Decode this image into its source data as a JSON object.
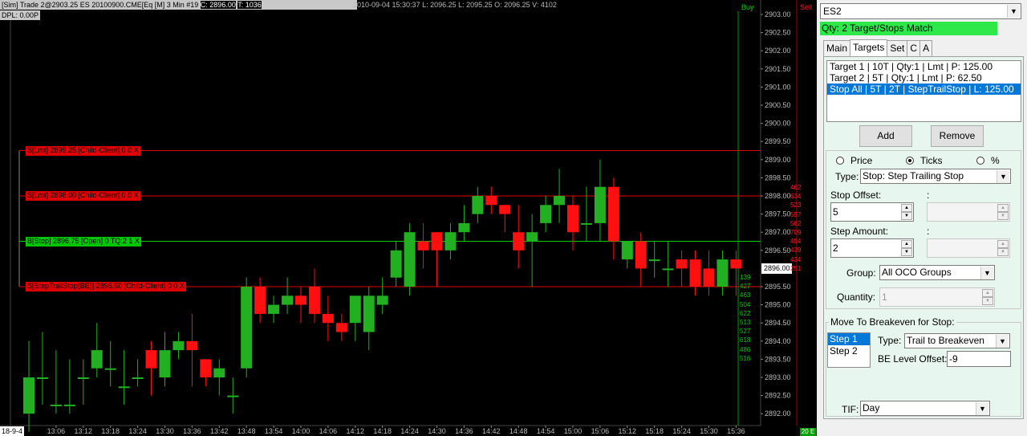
{
  "chart": {
    "header_title": "[Sim] Trade 2@2903.25 ES 20100900.CME[Eq [M] 3 Min #19",
    "header_close": "C: 2896.00",
    "header_t": "T: 1036",
    "header_info": "2010-09-04 15:30:37 L: 2096.25 L: 2095.25 O: 2096.25 V: 4102",
    "dpl": "DPL: 0.00P",
    "buy_label": "Buy",
    "sell_label": "Sell",
    "date_stamp": "18-9-4",
    "current_price": "2896.00",
    "position_badge": "20 E",
    "price_axis": [
      "2903.00",
      "2902.50",
      "2902.00",
      "2901.50",
      "2901.00",
      "2900.50",
      "2900.00",
      "2899.50",
      "2899.00",
      "2898.50",
      "2898.00",
      "2897.50",
      "2897.00",
      "2896.50",
      "2896.00",
      "2895.50",
      "2895.00",
      "2894.50",
      "2894.00",
      "2893.50",
      "2893.00",
      "2892.50",
      "2892.00"
    ],
    "time_axis": [
      "13:06",
      "13:12",
      "13:18",
      "13:24",
      "13:30",
      "13:36",
      "13:42",
      "13:48",
      "13:54",
      "14:00",
      "14:06",
      "14:12",
      "14:18",
      "14:24",
      "14:30",
      "14:36",
      "14:42",
      "14:48",
      "14:54",
      "15:00",
      "15:06",
      "15:12",
      "15:18",
      "15:24",
      "15:30",
      "15:36"
    ],
    "orders": [
      {
        "label": "S[Lmt] 2899.25 [Child-Client] 0 0 X",
        "price": 2899.25,
        "side": "sell"
      },
      {
        "label": "S[Lmt] 2898.00 [Child-Client] 0 0 X",
        "price": 2898.0,
        "side": "sell"
      },
      {
        "label": "B[Stop] 2896.75 [Open] 0 TQ:2 1 X",
        "price": 2896.75,
        "side": "buy"
      },
      {
        "label": "S[StepTrailStop(BE)] 2895.50 [Child-Client] 0 0 X",
        "price": 2895.5,
        "side": "sell"
      }
    ],
    "sell_volumes": [
      "462",
      "634",
      "523",
      "597",
      "562",
      "709",
      "494",
      "439",
      "434",
      "251"
    ],
    "buy_volumes": [
      "139",
      "427",
      "463",
      "504",
      "622",
      "513",
      "527",
      "618",
      "486",
      "516"
    ],
    "colors": {
      "up": "#22b022",
      "down": "#ff1010",
      "sell_line": "#e00000",
      "buy_line": "#00d000"
    }
  },
  "chart_data": {
    "type": "candlestick",
    "x": [
      "13:00",
      "13:03",
      "13:06",
      "13:09",
      "13:12",
      "13:15",
      "13:18",
      "13:21",
      "13:24",
      "13:27",
      "13:30",
      "13:33",
      "13:36",
      "13:39",
      "13:42",
      "13:45",
      "13:48",
      "13:51",
      "13:54",
      "13:57",
      "14:00",
      "14:03",
      "14:06",
      "14:09",
      "14:12",
      "14:15",
      "14:18",
      "14:21",
      "14:24",
      "14:27",
      "14:30",
      "14:33",
      "14:36",
      "14:39",
      "14:42",
      "14:45",
      "14:48",
      "14:51",
      "14:54",
      "14:57",
      "15:00",
      "15:03",
      "15:06",
      "15:09",
      "15:12",
      "15:15",
      "15:18",
      "15:21",
      "15:24",
      "15:27",
      "15:30",
      "15:33",
      "15:36"
    ],
    "open": [
      2892.0,
      2893.0,
      2892.25,
      2892.25,
      2893.0,
      2893.25,
      2893.25,
      2892.75,
      2893.0,
      2893.75,
      2893.0,
      2893.75,
      2894.0,
      2893.5,
      2893.0,
      2892.5,
      2893.25,
      2895.5,
      2894.75,
      2895.0,
      2895.25,
      2895.5,
      2894.75,
      2894.5,
      2894.5,
      2894.25,
      2895.0,
      2895.75,
      2895.5,
      2896.75,
      2897.0,
      2896.5,
      2897.0,
      2897.5,
      2898.0,
      2897.75,
      2897.0,
      2896.75,
      2897.25,
      2897.75,
      2897.75,
      2897.25,
      2897.25,
      2898.25,
      2896.25,
      2896.75,
      2896.25,
      2896.0,
      2896.25,
      2896.25,
      2896.0,
      2895.5,
      2896.25
    ],
    "close": [
      2893.0,
      2893.0,
      2892.25,
      2892.25,
      2893.0,
      2893.75,
      2893.25,
      2892.75,
      2893.0,
      2893.25,
      2893.75,
      2894.0,
      2893.75,
      2893.0,
      2893.25,
      2892.5,
      2895.5,
      2894.75,
      2895.0,
      2895.25,
      2895.0,
      2894.75,
      2894.5,
      2894.25,
      2895.25,
      2895.25,
      2895.25,
      2896.5,
      2897.0,
      2896.5,
      2896.5,
      2897.0,
      2897.25,
      2898.0,
      2897.75,
      2897.5,
      2896.5,
      2897.0,
      2897.75,
      2898.0,
      2897.0,
      2897.25,
      2898.25,
      2896.75,
      2896.75,
      2896.0,
      2896.25,
      2896.0,
      2896.0,
      2895.5,
      2895.5,
      2896.25,
      2896.0
    ],
    "high": [
      2894.0,
      2894.25,
      2893.75,
      2893.5,
      2893.5,
      2894.5,
      2894.0,
      2893.75,
      2893.5,
      2894.0,
      2894.25,
      2894.25,
      2894.75,
      2893.5,
      2893.5,
      2893.0,
      2895.75,
      2895.75,
      2895.25,
      2895.75,
      2895.5,
      2896.0,
      2895.25,
      2894.75,
      2895.25,
      2895.5,
      2895.75,
      2896.75,
      2897.25,
      2897.25,
      2896.75,
      2897.25,
      2897.75,
      2898.25,
      2898.25,
      2897.75,
      2897.75,
      2897.5,
      2898.0,
      2898.75,
      2898.0,
      2898.25,
      2899.0,
      2898.5,
      2896.75,
      2897.0,
      2896.75,
      2896.75,
      2896.5,
      2896.5,
      2896.5,
      2896.5,
      2896.5
    ],
    "low": [
      2891.5,
      2892.25,
      2892.0,
      2892.0,
      2892.25,
      2893.0,
      2892.75,
      2892.25,
      2892.75,
      2892.5,
      2892.75,
      2893.5,
      2892.75,
      2892.75,
      2892.5,
      2892.0,
      2893.0,
      2894.5,
      2894.5,
      2894.75,
      2894.5,
      2894.5,
      2894.0,
      2894.0,
      2894.0,
      2893.75,
      2894.75,
      2895.5,
      2895.25,
      2896.0,
      2895.5,
      2896.25,
      2896.75,
      2897.25,
      2897.5,
      2897.0,
      2896.0,
      2895.5,
      2897.0,
      2897.25,
      2896.5,
      2896.75,
      2896.75,
      2896.25,
      2896.0,
      2895.5,
      2895.75,
      2895.5,
      2895.5,
      2895.25,
      2895.25,
      2895.25,
      2895.25
    ]
  },
  "panel": {
    "symbol": "ES2",
    "qty_banner": "Qty: 2 Target/Stops Match",
    "tabs": [
      "Main",
      "Targets",
      "Set",
      "C",
      "A"
    ],
    "targets": [
      "Target 1 | 10T | Qty:1 | Lmt | P: 125.00",
      "Target 2 | 5T | Qty:1 | Lmt | P: 62.50",
      "Stop All | 5T | 2T | StepTrailStop | L: 125.00"
    ],
    "add_label": "Add",
    "remove_label": "Remove",
    "radio_price": "Price",
    "radio_ticks": "Ticks",
    "radio_pct": "%",
    "type_label": "Type:",
    "type_value": "Stop: Step Trailing Stop",
    "stop_offset_label": "Stop Offset:",
    "stop_offset_value": "5",
    "step_amount_label": "Step Amount:",
    "step_amount_value": "2",
    "colon": ":",
    "group_label": "Group:",
    "group_value": "All OCO Groups",
    "quantity_label": "Quantity:",
    "quantity_value": "1",
    "breakeven_title": "Move To Breakeven for Stop:",
    "steps": [
      "Step 1",
      "Step 2"
    ],
    "be_type_label": "Type:",
    "be_type_value": "Trail to Breakeven",
    "be_offset_label": "BE Level Offset:",
    "be_offset_value": "-9",
    "tif_label": "TIF:",
    "tif_value": "Day"
  }
}
